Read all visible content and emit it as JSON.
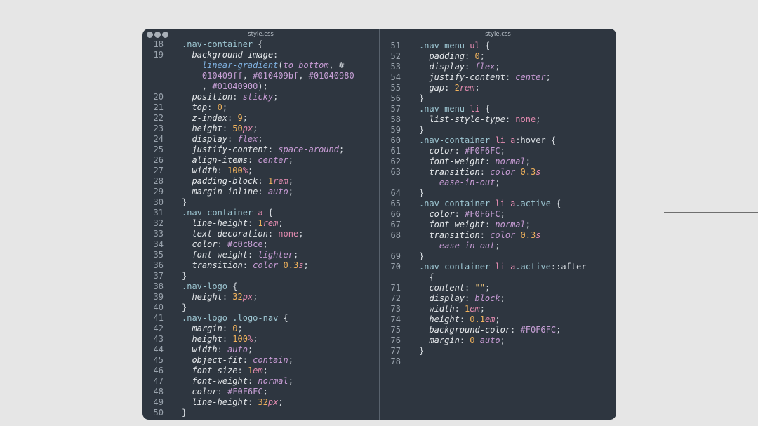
{
  "editor": {
    "left_file_name": "style.css",
    "right_file_name": "style.css"
  },
  "left_lines": [
    {
      "n": "18",
      "t": [
        [
          "sel",
          ".nav-container"
        ],
        [
          "pun",
          " {"
        ]
      ]
    },
    {
      "n": "19",
      "t": [
        [
          "pun",
          "  "
        ],
        [
          "prop",
          "background-image"
        ],
        [
          "pun",
          ":"
        ]
      ]
    },
    {
      "n": "",
      "t": [
        [
          "pun",
          "    "
        ],
        [
          "fn",
          "linear-gradient"
        ],
        [
          "pun",
          "("
        ],
        [
          "val",
          "to bottom"
        ],
        [
          "pun",
          ", #"
        ]
      ]
    },
    {
      "n": "",
      "t": [
        [
          "pun",
          "    "
        ],
        [
          "hex",
          "010409ff"
        ],
        [
          "pun",
          ", "
        ],
        [
          "hex",
          "#010409bf"
        ],
        [
          "pun",
          ", "
        ],
        [
          "hex",
          "#01040980"
        ]
      ]
    },
    {
      "n": "",
      "t": [
        [
          "pun",
          "    , "
        ],
        [
          "hex",
          "#01040900"
        ],
        [
          "pun",
          ");"
        ]
      ]
    },
    {
      "n": "20",
      "t": [
        [
          "pun",
          "  "
        ],
        [
          "prop",
          "position"
        ],
        [
          "pun",
          ": "
        ],
        [
          "val",
          "sticky"
        ],
        [
          "pun",
          ";"
        ]
      ]
    },
    {
      "n": "21",
      "t": [
        [
          "pun",
          "  "
        ],
        [
          "prop",
          "top"
        ],
        [
          "pun",
          ": "
        ],
        [
          "num",
          "0"
        ],
        [
          "pun",
          ";"
        ]
      ]
    },
    {
      "n": "22",
      "t": [
        [
          "pun",
          "  "
        ],
        [
          "prop",
          "z-index"
        ],
        [
          "pun",
          ": "
        ],
        [
          "num",
          "9"
        ],
        [
          "pun",
          ";"
        ]
      ]
    },
    {
      "n": "23",
      "t": [
        [
          "pun",
          "  "
        ],
        [
          "prop",
          "height"
        ],
        [
          "pun",
          ": "
        ],
        [
          "num",
          "50"
        ],
        [
          "unit",
          "px"
        ],
        [
          "pun",
          ";"
        ]
      ]
    },
    {
      "n": "24",
      "t": [
        [
          "pun",
          "  "
        ],
        [
          "prop",
          "display"
        ],
        [
          "pun",
          ": "
        ],
        [
          "val",
          "flex"
        ],
        [
          "pun",
          ";"
        ]
      ]
    },
    {
      "n": "25",
      "t": [
        [
          "pun",
          "  "
        ],
        [
          "prop",
          "justify-content"
        ],
        [
          "pun",
          ": "
        ],
        [
          "val",
          "space-around"
        ],
        [
          "pun",
          ";"
        ]
      ]
    },
    {
      "n": "26",
      "t": [
        [
          "pun",
          "  "
        ],
        [
          "prop",
          "align-items"
        ],
        [
          "pun",
          ": "
        ],
        [
          "val",
          "center"
        ],
        [
          "pun",
          ";"
        ]
      ]
    },
    {
      "n": "27",
      "t": [
        [
          "pun",
          "  "
        ],
        [
          "prop",
          "width"
        ],
        [
          "pun",
          ": "
        ],
        [
          "num",
          "100"
        ],
        [
          "unit",
          "%"
        ],
        [
          "pun",
          ";"
        ]
      ]
    },
    {
      "n": "28",
      "t": [
        [
          "pun",
          "  "
        ],
        [
          "prop",
          "padding-block"
        ],
        [
          "pun",
          ": "
        ],
        [
          "num",
          "1"
        ],
        [
          "unit",
          "rem"
        ],
        [
          "pun",
          ";"
        ]
      ]
    },
    {
      "n": "29",
      "t": [
        [
          "pun",
          "  "
        ],
        [
          "prop",
          "margin-inline"
        ],
        [
          "pun",
          ": "
        ],
        [
          "val",
          "auto"
        ],
        [
          "pun",
          ";"
        ]
      ]
    },
    {
      "n": "30",
      "t": [
        [
          "pun",
          "}"
        ]
      ]
    },
    {
      "n": "31",
      "t": [
        [
          "sel",
          ".nav-container"
        ],
        [
          "pun",
          " "
        ],
        [
          "tag",
          "a"
        ],
        [
          "pun",
          " {"
        ]
      ]
    },
    {
      "n": "32",
      "t": [
        [
          "pun",
          "  "
        ],
        [
          "prop",
          "line-height"
        ],
        [
          "pun",
          ": "
        ],
        [
          "num",
          "1"
        ],
        [
          "unit",
          "rem"
        ],
        [
          "pun",
          ";"
        ]
      ]
    },
    {
      "n": "33",
      "t": [
        [
          "pun",
          "  "
        ],
        [
          "prop",
          "text-decoration"
        ],
        [
          "pun",
          ": "
        ],
        [
          "tag",
          "none"
        ],
        [
          "pun",
          ";"
        ]
      ]
    },
    {
      "n": "34",
      "t": [
        [
          "pun",
          "  "
        ],
        [
          "prop",
          "color"
        ],
        [
          "pun",
          ": "
        ],
        [
          "hex",
          "#c0c8ce"
        ],
        [
          "pun",
          ";"
        ]
      ]
    },
    {
      "n": "35",
      "t": [
        [
          "pun",
          "  "
        ],
        [
          "prop",
          "font-weight"
        ],
        [
          "pun",
          ": "
        ],
        [
          "val",
          "lighter"
        ],
        [
          "pun",
          ";"
        ]
      ]
    },
    {
      "n": "36",
      "t": [
        [
          "pun",
          "  "
        ],
        [
          "prop",
          "transition"
        ],
        [
          "pun",
          ": "
        ],
        [
          "val",
          "color"
        ],
        [
          "pun",
          " "
        ],
        [
          "num",
          "0.3"
        ],
        [
          "unit",
          "s"
        ],
        [
          "pun",
          ";"
        ]
      ]
    },
    {
      "n": "37",
      "t": [
        [
          "pun",
          "}"
        ]
      ]
    },
    {
      "n": "38",
      "t": [
        [
          "sel",
          ".nav-logo"
        ],
        [
          "pun",
          " {"
        ]
      ]
    },
    {
      "n": "39",
      "t": [
        [
          "pun",
          "  "
        ],
        [
          "prop",
          "height"
        ],
        [
          "pun",
          ": "
        ],
        [
          "num",
          "32"
        ],
        [
          "unit",
          "px"
        ],
        [
          "pun",
          ";"
        ]
      ]
    },
    {
      "n": "40",
      "t": [
        [
          "pun",
          "}"
        ]
      ]
    },
    {
      "n": "41",
      "t": [
        [
          "sel",
          ".nav-logo"
        ],
        [
          "pun",
          " "
        ],
        [
          "cls",
          ".logo-nav"
        ],
        [
          "pun",
          " {"
        ]
      ]
    },
    {
      "n": "42",
      "t": [
        [
          "pun",
          "  "
        ],
        [
          "prop",
          "margin"
        ],
        [
          "pun",
          ": "
        ],
        [
          "num",
          "0"
        ],
        [
          "pun",
          ";"
        ]
      ]
    },
    {
      "n": "43",
      "t": [
        [
          "pun",
          "  "
        ],
        [
          "prop",
          "height"
        ],
        [
          "pun",
          ": "
        ],
        [
          "num",
          "100"
        ],
        [
          "unit",
          "%"
        ],
        [
          "pun",
          ";"
        ]
      ]
    },
    {
      "n": "44",
      "t": [
        [
          "pun",
          "  "
        ],
        [
          "prop",
          "width"
        ],
        [
          "pun",
          ": "
        ],
        [
          "val",
          "auto"
        ],
        [
          "pun",
          ";"
        ]
      ]
    },
    {
      "n": "45",
      "t": [
        [
          "pun",
          "  "
        ],
        [
          "prop",
          "object-fit"
        ],
        [
          "pun",
          ": "
        ],
        [
          "val",
          "contain"
        ],
        [
          "pun",
          ";"
        ]
      ]
    },
    {
      "n": "46",
      "t": [
        [
          "pun",
          "  "
        ],
        [
          "prop",
          "font-size"
        ],
        [
          "pun",
          ": "
        ],
        [
          "num",
          "1"
        ],
        [
          "unit",
          "em"
        ],
        [
          "pun",
          ";"
        ]
      ]
    },
    {
      "n": "47",
      "t": [
        [
          "pun",
          "  "
        ],
        [
          "prop",
          "font-weight"
        ],
        [
          "pun",
          ": "
        ],
        [
          "val",
          "normal"
        ],
        [
          "pun",
          ";"
        ]
      ]
    },
    {
      "n": "48",
      "t": [
        [
          "pun",
          "  "
        ],
        [
          "prop",
          "color"
        ],
        [
          "pun",
          ": "
        ],
        [
          "hex",
          "#F0F6FC"
        ],
        [
          "pun",
          ";"
        ]
      ]
    },
    {
      "n": "49",
      "t": [
        [
          "pun",
          "  "
        ],
        [
          "prop",
          "line-height"
        ],
        [
          "pun",
          ": "
        ],
        [
          "num",
          "32"
        ],
        [
          "unit",
          "px"
        ],
        [
          "pun",
          ";"
        ]
      ]
    },
    {
      "n": "50",
      "t": [
        [
          "pun",
          "}"
        ]
      ]
    }
  ],
  "right_lines": [
    {
      "n": "51",
      "t": [
        [
          "sel",
          ".nav-menu"
        ],
        [
          "pun",
          " "
        ],
        [
          "tag",
          "ul"
        ],
        [
          "pun",
          " {"
        ]
      ]
    },
    {
      "n": "52",
      "t": [
        [
          "pun",
          "  "
        ],
        [
          "prop",
          "padding"
        ],
        [
          "pun",
          ": "
        ],
        [
          "num",
          "0"
        ],
        [
          "pun",
          ";"
        ]
      ]
    },
    {
      "n": "53",
      "t": [
        [
          "pun",
          "  "
        ],
        [
          "prop",
          "display"
        ],
        [
          "pun",
          ": "
        ],
        [
          "val",
          "flex"
        ],
        [
          "pun",
          ";"
        ]
      ]
    },
    {
      "n": "54",
      "t": [
        [
          "pun",
          "  "
        ],
        [
          "prop",
          "justify-content"
        ],
        [
          "pun",
          ": "
        ],
        [
          "val",
          "center"
        ],
        [
          "pun",
          ";"
        ]
      ]
    },
    {
      "n": "55",
      "t": [
        [
          "pun",
          "  "
        ],
        [
          "prop",
          "gap"
        ],
        [
          "pun",
          ": "
        ],
        [
          "num",
          "2"
        ],
        [
          "unit",
          "rem"
        ],
        [
          "pun",
          ";"
        ]
      ]
    },
    {
      "n": "56",
      "t": [
        [
          "pun",
          "}"
        ]
      ]
    },
    {
      "n": "57",
      "t": [
        [
          "sel",
          ".nav-menu"
        ],
        [
          "pun",
          " "
        ],
        [
          "tag",
          "li"
        ],
        [
          "pun",
          " {"
        ]
      ]
    },
    {
      "n": "58",
      "t": [
        [
          "pun",
          "  "
        ],
        [
          "prop",
          "list-style-type"
        ],
        [
          "pun",
          ": "
        ],
        [
          "tag",
          "none"
        ],
        [
          "pun",
          ";"
        ]
      ]
    },
    {
      "n": "59",
      "t": [
        [
          "pun",
          "}"
        ]
      ]
    },
    {
      "n": "60",
      "t": [
        [
          "sel",
          ".nav-container"
        ],
        [
          "pun",
          " "
        ],
        [
          "tag",
          "li"
        ],
        [
          "pun",
          " "
        ],
        [
          "tag",
          "a"
        ],
        [
          "pun",
          ":hover {"
        ]
      ]
    },
    {
      "n": "61",
      "t": [
        [
          "pun",
          "  "
        ],
        [
          "prop",
          "color"
        ],
        [
          "pun",
          ": "
        ],
        [
          "hex",
          "#F0F6FC"
        ],
        [
          "pun",
          ";"
        ]
      ]
    },
    {
      "n": "62",
      "t": [
        [
          "pun",
          "  "
        ],
        [
          "prop",
          "font-weight"
        ],
        [
          "pun",
          ": "
        ],
        [
          "val",
          "normal"
        ],
        [
          "pun",
          ";"
        ]
      ]
    },
    {
      "n": "63",
      "t": [
        [
          "pun",
          "  "
        ],
        [
          "prop",
          "transition"
        ],
        [
          "pun",
          ": "
        ],
        [
          "val",
          "color"
        ],
        [
          "pun",
          " "
        ],
        [
          "num",
          "0.3"
        ],
        [
          "unit",
          "s"
        ]
      ]
    },
    {
      "n": "",
      "t": [
        [
          "pun",
          "    "
        ],
        [
          "val",
          "ease-in-out"
        ],
        [
          "pun",
          ";"
        ]
      ]
    },
    {
      "n": "64",
      "t": [
        [
          "pun",
          "}"
        ]
      ]
    },
    {
      "n": "65",
      "t": [
        [
          "sel",
          ".nav-container"
        ],
        [
          "pun",
          " "
        ],
        [
          "tag",
          "li"
        ],
        [
          "pun",
          " "
        ],
        [
          "tag",
          "a"
        ],
        [
          "cls",
          ".active"
        ],
        [
          "pun",
          " {"
        ]
      ]
    },
    {
      "n": "66",
      "t": [
        [
          "pun",
          "  "
        ],
        [
          "prop",
          "color"
        ],
        [
          "pun",
          ": "
        ],
        [
          "hex",
          "#F0F6FC"
        ],
        [
          "pun",
          ";"
        ]
      ]
    },
    {
      "n": "67",
      "t": [
        [
          "pun",
          "  "
        ],
        [
          "prop",
          "font-weight"
        ],
        [
          "pun",
          ": "
        ],
        [
          "val",
          "normal"
        ],
        [
          "pun",
          ";"
        ]
      ]
    },
    {
      "n": "68",
      "t": [
        [
          "pun",
          "  "
        ],
        [
          "prop",
          "transition"
        ],
        [
          "pun",
          ": "
        ],
        [
          "val",
          "color"
        ],
        [
          "pun",
          " "
        ],
        [
          "num",
          "0.3"
        ],
        [
          "unit",
          "s"
        ]
      ]
    },
    {
      "n": "",
      "t": [
        [
          "pun",
          "    "
        ],
        [
          "val",
          "ease-in-out"
        ],
        [
          "pun",
          ";"
        ]
      ]
    },
    {
      "n": "69",
      "t": [
        [
          "pun",
          "}"
        ]
      ]
    },
    {
      "n": "70",
      "t": [
        [
          "sel",
          ".nav-container"
        ],
        [
          "pun",
          " "
        ],
        [
          "tag",
          "li"
        ],
        [
          "pun",
          " "
        ],
        [
          "tag",
          "a"
        ],
        [
          "cls",
          ".active"
        ],
        [
          "pun",
          "::after"
        ]
      ]
    },
    {
      "n": "",
      "t": [
        [
          "pun",
          "  {"
        ]
      ]
    },
    {
      "n": "71",
      "t": [
        [
          "pun",
          "  "
        ],
        [
          "prop",
          "content"
        ],
        [
          "pun",
          ": "
        ],
        [
          "str",
          "\"\""
        ],
        [
          "pun",
          ";"
        ]
      ]
    },
    {
      "n": "72",
      "t": [
        [
          "pun",
          "  "
        ],
        [
          "prop",
          "display"
        ],
        [
          "pun",
          ": "
        ],
        [
          "val",
          "block"
        ],
        [
          "pun",
          ";"
        ]
      ]
    },
    {
      "n": "73",
      "t": [
        [
          "pun",
          "  "
        ],
        [
          "prop",
          "width"
        ],
        [
          "pun",
          ": "
        ],
        [
          "num",
          "1"
        ],
        [
          "unit",
          "em"
        ],
        [
          "pun",
          ";"
        ]
      ]
    },
    {
      "n": "74",
      "t": [
        [
          "pun",
          "  "
        ],
        [
          "prop",
          "height"
        ],
        [
          "pun",
          ": "
        ],
        [
          "num",
          "0.1"
        ],
        [
          "unit",
          "em"
        ],
        [
          "pun",
          ";"
        ]
      ]
    },
    {
      "n": "75",
      "t": [
        [
          "pun",
          "  "
        ],
        [
          "prop",
          "background-color"
        ],
        [
          "pun",
          ": "
        ],
        [
          "hex",
          "#F0F6FC"
        ],
        [
          "pun",
          ";"
        ]
      ]
    },
    {
      "n": "76",
      "t": [
        [
          "pun",
          "  "
        ],
        [
          "prop",
          "margin"
        ],
        [
          "pun",
          ": "
        ],
        [
          "num",
          "0"
        ],
        [
          "pun",
          " "
        ],
        [
          "val",
          "auto"
        ],
        [
          "pun",
          ";"
        ]
      ]
    },
    {
      "n": "77",
      "t": [
        [
          "pun",
          "}"
        ]
      ]
    },
    {
      "n": "78",
      "t": []
    }
  ]
}
